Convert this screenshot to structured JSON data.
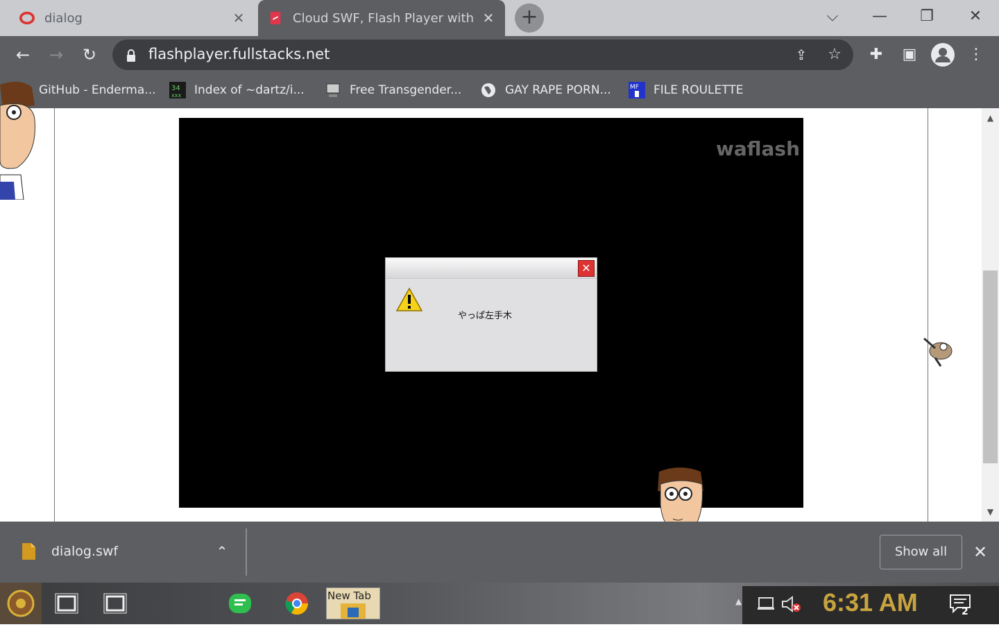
{
  "tabs": [
    {
      "label": "dialog",
      "icon": "opera-icon",
      "active": false
    },
    {
      "label": "Cloud SWF, Flash Player with L",
      "icon": "flash-file-icon",
      "active": true
    }
  ],
  "window_controls": [
    "chevron-down-icon",
    "minimize-icon",
    "restore-icon",
    "close-icon"
  ],
  "address_bar": {
    "url": "flashplayer.fullstacks.net"
  },
  "bookmarks": [
    {
      "label": "GitHub - Enderma...",
      "icon": "avatar-icon"
    },
    {
      "label": "Index of ~dartz/i...",
      "icon": "dartz-icon"
    },
    {
      "label": "Free Transgender...",
      "icon": "computer-icon"
    },
    {
      "label": "GAY RAPE PORN...",
      "icon": "globe-icon"
    },
    {
      "label": "FILE ROULETTE",
      "icon": "mf-icon"
    }
  ],
  "flash": {
    "watermark": "waflash",
    "dialog": {
      "message": "やっぱ左手木"
    }
  },
  "downloads": {
    "file_name": "dialog.swf",
    "show_all_label": "Show all"
  },
  "taskbar": {
    "new_tab_label": "New Tab",
    "clock": "6:31 AM",
    "notification_count": "2"
  },
  "colors": {
    "tab_strip": "#c9cbcf",
    "toolbar": "#5c5e62",
    "flash_bg": "#000000",
    "clock": "#c8a440"
  }
}
